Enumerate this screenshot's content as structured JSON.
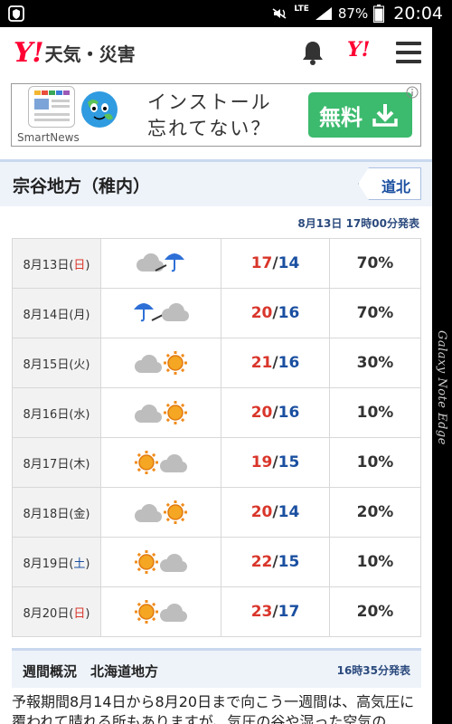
{
  "status_bar": {
    "network": "LTE",
    "battery": "87%",
    "time": "20:04"
  },
  "edge_label": "Galaxy Note Edge",
  "header": {
    "logo_mark": "Y!",
    "logo_text": "天気・災害",
    "yahoo_button": "Y!"
  },
  "ad": {
    "brand": "SmartNews",
    "copy_line1": "インストール",
    "copy_line2": "忘れてない？",
    "button_label": "無料"
  },
  "region": {
    "title": "宗谷地方（稚内）",
    "tab_label": "道北"
  },
  "forecast": {
    "issued": "8月13日 17時00分発表",
    "rows": [
      {
        "date": "8月13日",
        "dow": "日",
        "weather": "cloudy-then-rain",
        "high": "17",
        "low": "14",
        "pop": "70%"
      },
      {
        "date": "8月14日",
        "dow": "月",
        "weather": "rain-then-cloudy",
        "high": "20",
        "low": "16",
        "pop": "70%"
      },
      {
        "date": "8月15日",
        "dow": "火",
        "weather": "cloudy-then-sunny",
        "high": "21",
        "low": "16",
        "pop": "30%"
      },
      {
        "date": "8月16日",
        "dow": "水",
        "weather": "cloudy-then-sunny",
        "high": "20",
        "low": "16",
        "pop": "10%"
      },
      {
        "date": "8月17日",
        "dow": "木",
        "weather": "sunny-then-cloudy",
        "high": "19",
        "low": "15",
        "pop": "10%"
      },
      {
        "date": "8月18日",
        "dow": "金",
        "weather": "cloudy-then-sunny",
        "high": "20",
        "low": "14",
        "pop": "20%"
      },
      {
        "date": "8月19日",
        "dow": "土",
        "weather": "sunny-then-cloudy",
        "high": "22",
        "low": "15",
        "pop": "10%"
      },
      {
        "date": "8月20日",
        "dow": "日",
        "weather": "sunny-then-cloudy",
        "high": "23",
        "low": "17",
        "pop": "20%"
      }
    ]
  },
  "weekly": {
    "title": "週間概況　北海道地方",
    "time": "16時35分発表",
    "body": "予報期間8月14日から8月20日まで向こう一週間は、高気圧に覆われて晴れる所もありますが、気圧の谷や湿った空気の"
  },
  "colors": {
    "high_temp": "#d9362b",
    "low_temp": "#1a4fa0",
    "sunday": "#d9362b",
    "saturday": "#1a4fa0",
    "brand_red": "#ff0033",
    "ad_green": "#3cba6e"
  }
}
